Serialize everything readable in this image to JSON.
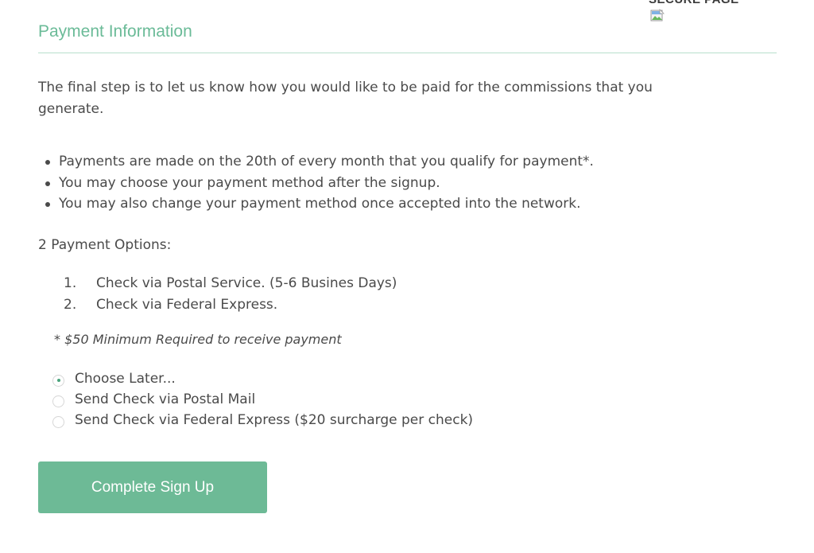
{
  "header": {
    "secure_label": "SECURE PAGE",
    "title": "Payment Information"
  },
  "intro": "The final step is to let us know how you would like to be paid for the commissions that you generate.",
  "bullets": [
    "Payments are made on the 20th of every month that you qualify for payment*.",
    "You may choose your payment method after the signup.",
    "You may also change your payment method once accepted into the network."
  ],
  "options_label": "2 Payment Options:",
  "options": [
    {
      "num": "1.",
      "text": "Check via Postal Service. (5-6 Busines Days)"
    },
    {
      "num": "2.",
      "text": "Check via Federal Express."
    }
  ],
  "minimum_note": "* $50 Minimum Required to receive payment",
  "payment_method": {
    "selected": "Choose Later...",
    "choices": [
      {
        "label": "Choose Later...",
        "checked": true
      },
      {
        "label": "Send Check via Postal Mail",
        "checked": false
      },
      {
        "label": "Send Check via Federal Express ($20 surcharge per check)",
        "checked": false
      }
    ]
  },
  "submit_label": "Complete Sign Up",
  "colors": {
    "accent": "#6dba96",
    "title": "#6bbb98",
    "rule": "#b8e0cc",
    "text": "#4a4a4a"
  }
}
